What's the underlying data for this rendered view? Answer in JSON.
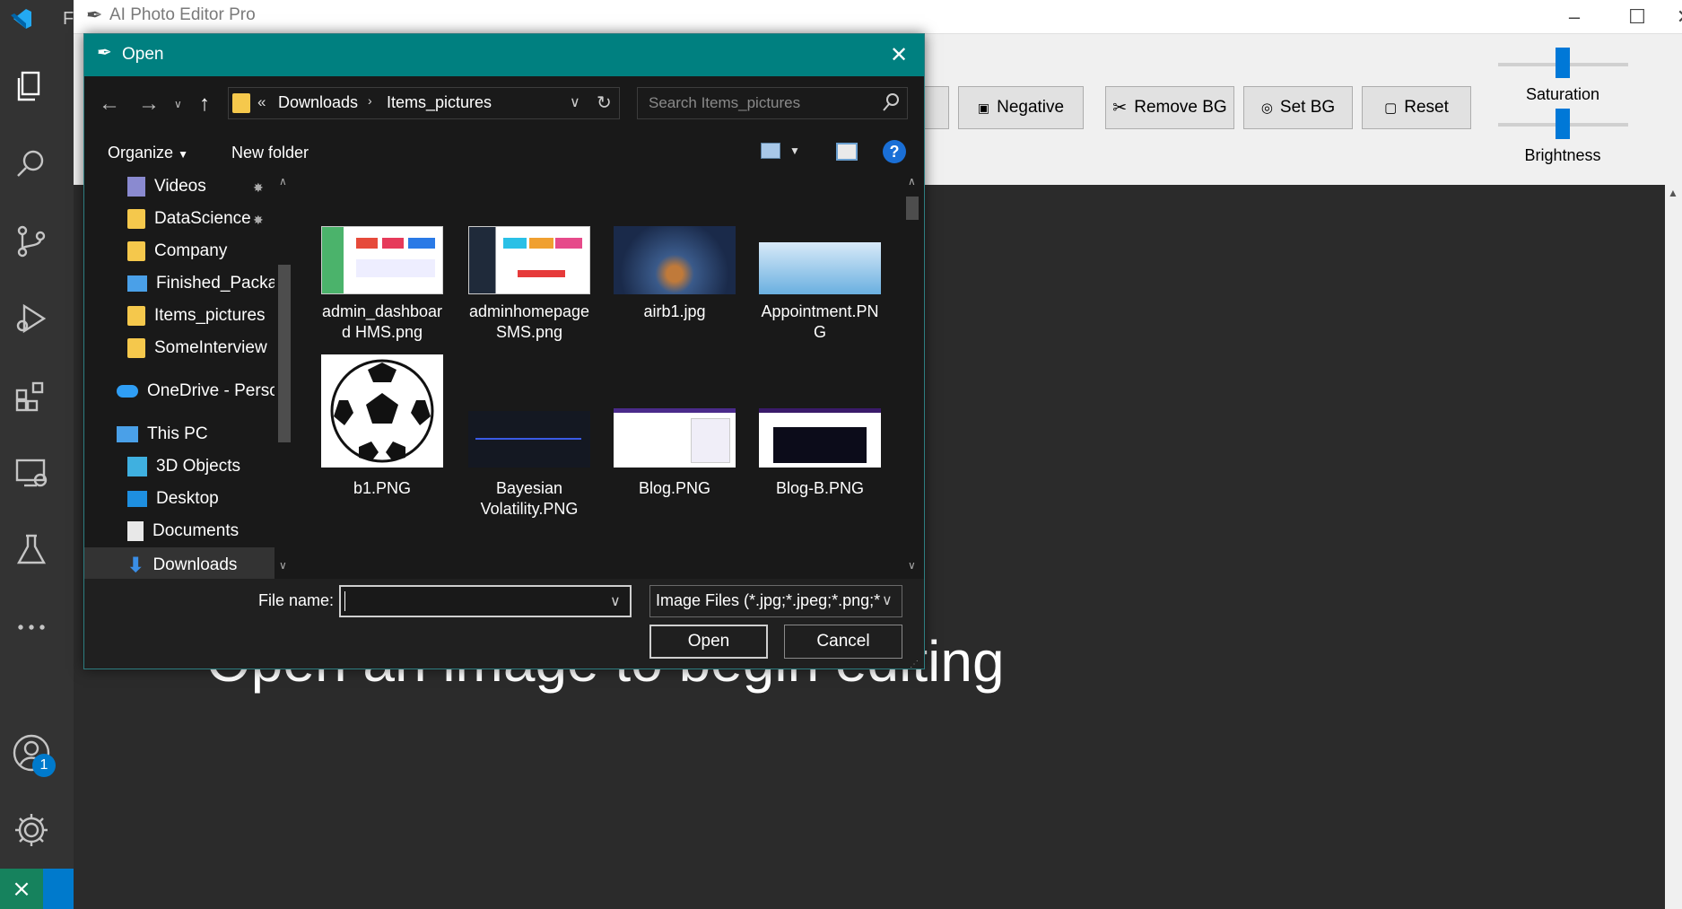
{
  "app": {
    "title": "AI Photo Editor Pro",
    "canvas_placeholder": "Open an image to begin editing",
    "toolbar": {
      "negative_label": "Negative",
      "remove_bg_label": "Remove BG",
      "set_bg_label": "Set BG",
      "reset_label": "Reset"
    },
    "sliders": {
      "saturation_label": "Saturation",
      "brightness_label": "Brightness"
    }
  },
  "vscode": {
    "title_fragment": "F",
    "accounts_badge": "1"
  },
  "dialog": {
    "title": "Open",
    "breadcrumb": {
      "overflow": "«",
      "items": [
        "Downloads",
        "Items_pictures"
      ]
    },
    "search_placeholder": "Search Items_pictures",
    "organize_label": "Organize",
    "new_folder_label": "New folder",
    "help_label": "?",
    "nav_items": [
      {
        "label": "Videos",
        "icon": "videos-icon",
        "pinned": true
      },
      {
        "label": "DataScience",
        "icon": "folder-icon",
        "pinned": true
      },
      {
        "label": "Company",
        "icon": "folder-icon"
      },
      {
        "label": "Finished_Packag",
        "icon": "monitor-folder-icon"
      },
      {
        "label": "Items_pictures",
        "icon": "folder-icon"
      },
      {
        "label": "SomeInterview",
        "icon": "folder-icon"
      },
      {
        "label": "OneDrive - Persor",
        "icon": "onedrive-icon"
      },
      {
        "label": "This PC",
        "icon": "this-pc-icon"
      },
      {
        "label": "3D Objects",
        "icon": "3d-objects-icon"
      },
      {
        "label": "Desktop",
        "icon": "desktop-icon"
      },
      {
        "label": "Documents",
        "icon": "documents-icon"
      },
      {
        "label": "Downloads",
        "icon": "downloads-icon"
      }
    ],
    "files": [
      {
        "line1": "admin_dashboar",
        "line2": "d HMS.png"
      },
      {
        "line1": "adminhomepage",
        "line2": "SMS.png"
      },
      {
        "line1": "airb1.jpg",
        "line2": ""
      },
      {
        "line1": "Appointment.PN",
        "line2": "G"
      },
      {
        "line1": "b1.PNG",
        "line2": ""
      },
      {
        "line1": "Bayesian",
        "line2": "Volatility.PNG"
      },
      {
        "line1": "Blog.PNG",
        "line2": ""
      },
      {
        "line1": "Blog-B.PNG",
        "line2": ""
      }
    ],
    "file_name_label": "File name:",
    "file_name_value": "",
    "file_type_value": "Image Files (*.jpg;*.jpeg;*.png;*",
    "open_label": "Open",
    "cancel_label": "Cancel"
  },
  "colors": {
    "dialog_title_bar": "#008080",
    "vscode_activity_bar": "#333333",
    "accent_blue": "#0078d7"
  }
}
